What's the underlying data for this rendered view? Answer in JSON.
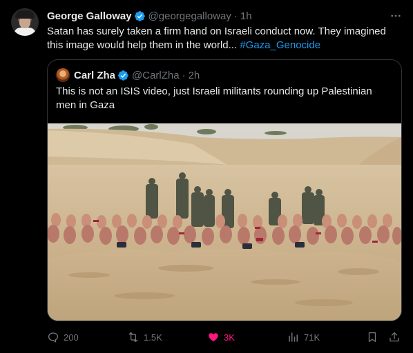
{
  "author": {
    "name": "George Galloway",
    "handle": "@georgegalloway",
    "separator": "·",
    "time": "1h"
  },
  "tweet": {
    "text": "Satan has surely taken a firm hand on Israeli conduct now. They imagined this image would help them in the world... ",
    "hashtag": "#Gaza_Genocide"
  },
  "quote": {
    "author": {
      "name": "Carl Zha",
      "handle": "@CarlZha",
      "separator": "·",
      "time": "2h"
    },
    "text": "This is not an ISIS video, just Israeli militants rounding up Palestinian men in Gaza"
  },
  "actions": {
    "reply_count": "200",
    "repost_count": "1.5K",
    "like_count": "3K",
    "view_count": "71K"
  },
  "icons": {
    "verified": "verified-badge-icon",
    "more": "more-options-icon",
    "reply": "reply-icon",
    "repost": "repost-icon",
    "like": "heart-icon",
    "views": "views-icon",
    "bookmark": "bookmark-icon",
    "share": "share-icon"
  },
  "colors": {
    "background": "#000000",
    "text": "#e7e9ea",
    "muted": "#71767b",
    "link": "#1d9bf0",
    "like": "#f91880",
    "border": "#2f3336"
  }
}
